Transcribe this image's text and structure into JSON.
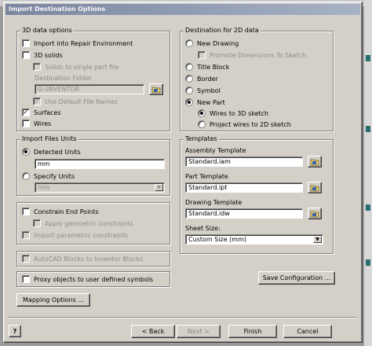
{
  "window": {
    "title": "Import Destination Options"
  },
  "group_3d": {
    "title": "3D data options",
    "import_repair": {
      "label": "Import into Repair Environment",
      "checked": false
    },
    "solids_3d": {
      "label": "3D solids",
      "checked": false
    },
    "solids_single": {
      "label": "Solids to single part file",
      "checked": false
    },
    "dest_folder_label": "Destination Folder",
    "dest_folder_value": "G:\\INVENTOR",
    "default_filenames": {
      "label": "Use Default File Names",
      "checked": true
    },
    "surfaces": {
      "label": "Surfaces",
      "checked": true
    },
    "wires": {
      "label": "Wires",
      "checked": false
    }
  },
  "group_units": {
    "title": "Import Files Units",
    "detected": {
      "label": "Detected Units",
      "selected": true
    },
    "detected_value": "mm",
    "specify": {
      "label": "Specify Units",
      "selected": false
    },
    "specify_value": "mm"
  },
  "group_constrain": {
    "constrain_end": {
      "label": "Constrain End Points",
      "checked": false
    },
    "apply_geometric": {
      "label": "Apply geometric constraints",
      "checked": false
    },
    "import_parametric": {
      "label": "Import parametric constraints",
      "checked": false
    }
  },
  "autocad_blocks": {
    "label": "AutoCAD Blocks to Inventor Blocks",
    "checked": false
  },
  "proxy_objects": {
    "label": "Proxy objects to user defined symbols",
    "checked": false
  },
  "mapping_button": "Mapping Options ...",
  "group_2d": {
    "title": "Destination for 2D data",
    "new_drawing": {
      "label": "New Drawing",
      "selected": false
    },
    "promote_dims": {
      "label": "Promote Dimensions To Sketch",
      "checked": false
    },
    "title_block": {
      "label": "Title Block",
      "selected": false
    },
    "border": {
      "label": "Border",
      "selected": false
    },
    "symbol": {
      "label": "Symbol",
      "selected": false
    },
    "new_part": {
      "label": "New Part",
      "selected": true
    },
    "wires_3d": {
      "label": "Wires to 3D sketch",
      "selected": true
    },
    "project_2d": {
      "label": "Project wires to 2D sketch",
      "selected": false
    }
  },
  "group_templates": {
    "title": "Templates",
    "assembly_label": "Assembly Template",
    "assembly_value": "Standard.iam",
    "part_label": "Part Template",
    "part_value": "Standard.ipt",
    "drawing_label": "Drawing Template",
    "drawing_value": "Standard.idw",
    "sheet_label": "Sheet Size:",
    "sheet_value": "Custom Size (mm)"
  },
  "save_config_button": "Save Configuration ...",
  "help_icon_glyph": "?",
  "nav": {
    "back": "< Back",
    "next": "Next >",
    "finish": "Finish",
    "cancel": "Cancel"
  },
  "check_glyph": "✓",
  "arrow_glyph": "▼",
  "colors": {
    "title_bar": "#7a86a0",
    "face": "#d4d0c8",
    "disabled_text": "#8c8c8c"
  }
}
